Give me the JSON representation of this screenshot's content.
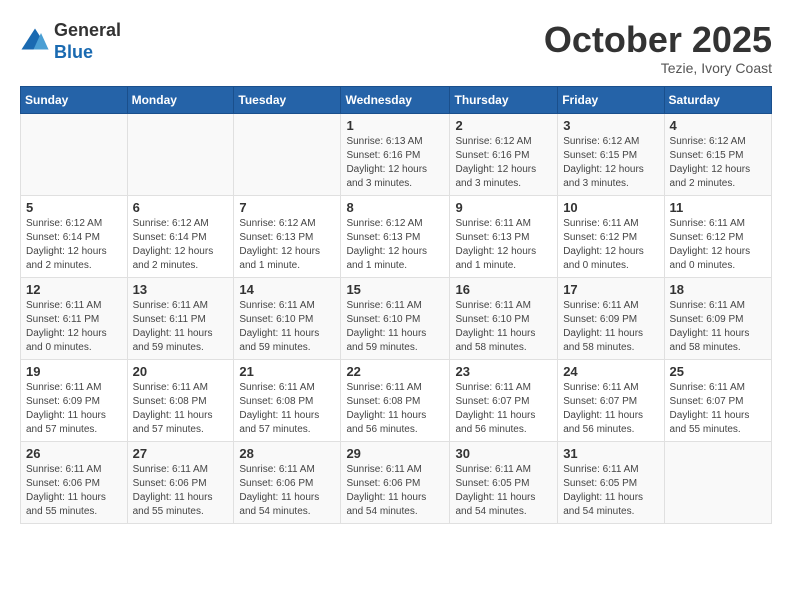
{
  "header": {
    "logo_line1": "General",
    "logo_line2": "Blue",
    "month": "October 2025",
    "location": "Tezie, Ivory Coast"
  },
  "days_of_week": [
    "Sunday",
    "Monday",
    "Tuesday",
    "Wednesday",
    "Thursday",
    "Friday",
    "Saturday"
  ],
  "weeks": [
    [
      {
        "day": "",
        "info": ""
      },
      {
        "day": "",
        "info": ""
      },
      {
        "day": "",
        "info": ""
      },
      {
        "day": "1",
        "info": "Sunrise: 6:13 AM\nSunset: 6:16 PM\nDaylight: 12 hours and 3 minutes."
      },
      {
        "day": "2",
        "info": "Sunrise: 6:12 AM\nSunset: 6:16 PM\nDaylight: 12 hours and 3 minutes."
      },
      {
        "day": "3",
        "info": "Sunrise: 6:12 AM\nSunset: 6:15 PM\nDaylight: 12 hours and 3 minutes."
      },
      {
        "day": "4",
        "info": "Sunrise: 6:12 AM\nSunset: 6:15 PM\nDaylight: 12 hours and 2 minutes."
      }
    ],
    [
      {
        "day": "5",
        "info": "Sunrise: 6:12 AM\nSunset: 6:14 PM\nDaylight: 12 hours and 2 minutes."
      },
      {
        "day": "6",
        "info": "Sunrise: 6:12 AM\nSunset: 6:14 PM\nDaylight: 12 hours and 2 minutes."
      },
      {
        "day": "7",
        "info": "Sunrise: 6:12 AM\nSunset: 6:13 PM\nDaylight: 12 hours and 1 minute."
      },
      {
        "day": "8",
        "info": "Sunrise: 6:12 AM\nSunset: 6:13 PM\nDaylight: 12 hours and 1 minute."
      },
      {
        "day": "9",
        "info": "Sunrise: 6:11 AM\nSunset: 6:13 PM\nDaylight: 12 hours and 1 minute."
      },
      {
        "day": "10",
        "info": "Sunrise: 6:11 AM\nSunset: 6:12 PM\nDaylight: 12 hours and 0 minutes."
      },
      {
        "day": "11",
        "info": "Sunrise: 6:11 AM\nSunset: 6:12 PM\nDaylight: 12 hours and 0 minutes."
      }
    ],
    [
      {
        "day": "12",
        "info": "Sunrise: 6:11 AM\nSunset: 6:11 PM\nDaylight: 12 hours and 0 minutes."
      },
      {
        "day": "13",
        "info": "Sunrise: 6:11 AM\nSunset: 6:11 PM\nDaylight: 11 hours and 59 minutes."
      },
      {
        "day": "14",
        "info": "Sunrise: 6:11 AM\nSunset: 6:10 PM\nDaylight: 11 hours and 59 minutes."
      },
      {
        "day": "15",
        "info": "Sunrise: 6:11 AM\nSunset: 6:10 PM\nDaylight: 11 hours and 59 minutes."
      },
      {
        "day": "16",
        "info": "Sunrise: 6:11 AM\nSunset: 6:10 PM\nDaylight: 11 hours and 58 minutes."
      },
      {
        "day": "17",
        "info": "Sunrise: 6:11 AM\nSunset: 6:09 PM\nDaylight: 11 hours and 58 minutes."
      },
      {
        "day": "18",
        "info": "Sunrise: 6:11 AM\nSunset: 6:09 PM\nDaylight: 11 hours and 58 minutes."
      }
    ],
    [
      {
        "day": "19",
        "info": "Sunrise: 6:11 AM\nSunset: 6:09 PM\nDaylight: 11 hours and 57 minutes."
      },
      {
        "day": "20",
        "info": "Sunrise: 6:11 AM\nSunset: 6:08 PM\nDaylight: 11 hours and 57 minutes."
      },
      {
        "day": "21",
        "info": "Sunrise: 6:11 AM\nSunset: 6:08 PM\nDaylight: 11 hours and 57 minutes."
      },
      {
        "day": "22",
        "info": "Sunrise: 6:11 AM\nSunset: 6:08 PM\nDaylight: 11 hours and 56 minutes."
      },
      {
        "day": "23",
        "info": "Sunrise: 6:11 AM\nSunset: 6:07 PM\nDaylight: 11 hours and 56 minutes."
      },
      {
        "day": "24",
        "info": "Sunrise: 6:11 AM\nSunset: 6:07 PM\nDaylight: 11 hours and 56 minutes."
      },
      {
        "day": "25",
        "info": "Sunrise: 6:11 AM\nSunset: 6:07 PM\nDaylight: 11 hours and 55 minutes."
      }
    ],
    [
      {
        "day": "26",
        "info": "Sunrise: 6:11 AM\nSunset: 6:06 PM\nDaylight: 11 hours and 55 minutes."
      },
      {
        "day": "27",
        "info": "Sunrise: 6:11 AM\nSunset: 6:06 PM\nDaylight: 11 hours and 55 minutes."
      },
      {
        "day": "28",
        "info": "Sunrise: 6:11 AM\nSunset: 6:06 PM\nDaylight: 11 hours and 54 minutes."
      },
      {
        "day": "29",
        "info": "Sunrise: 6:11 AM\nSunset: 6:06 PM\nDaylight: 11 hours and 54 minutes."
      },
      {
        "day": "30",
        "info": "Sunrise: 6:11 AM\nSunset: 6:05 PM\nDaylight: 11 hours and 54 minutes."
      },
      {
        "day": "31",
        "info": "Sunrise: 6:11 AM\nSunset: 6:05 PM\nDaylight: 11 hours and 54 minutes."
      },
      {
        "day": "",
        "info": ""
      }
    ]
  ]
}
